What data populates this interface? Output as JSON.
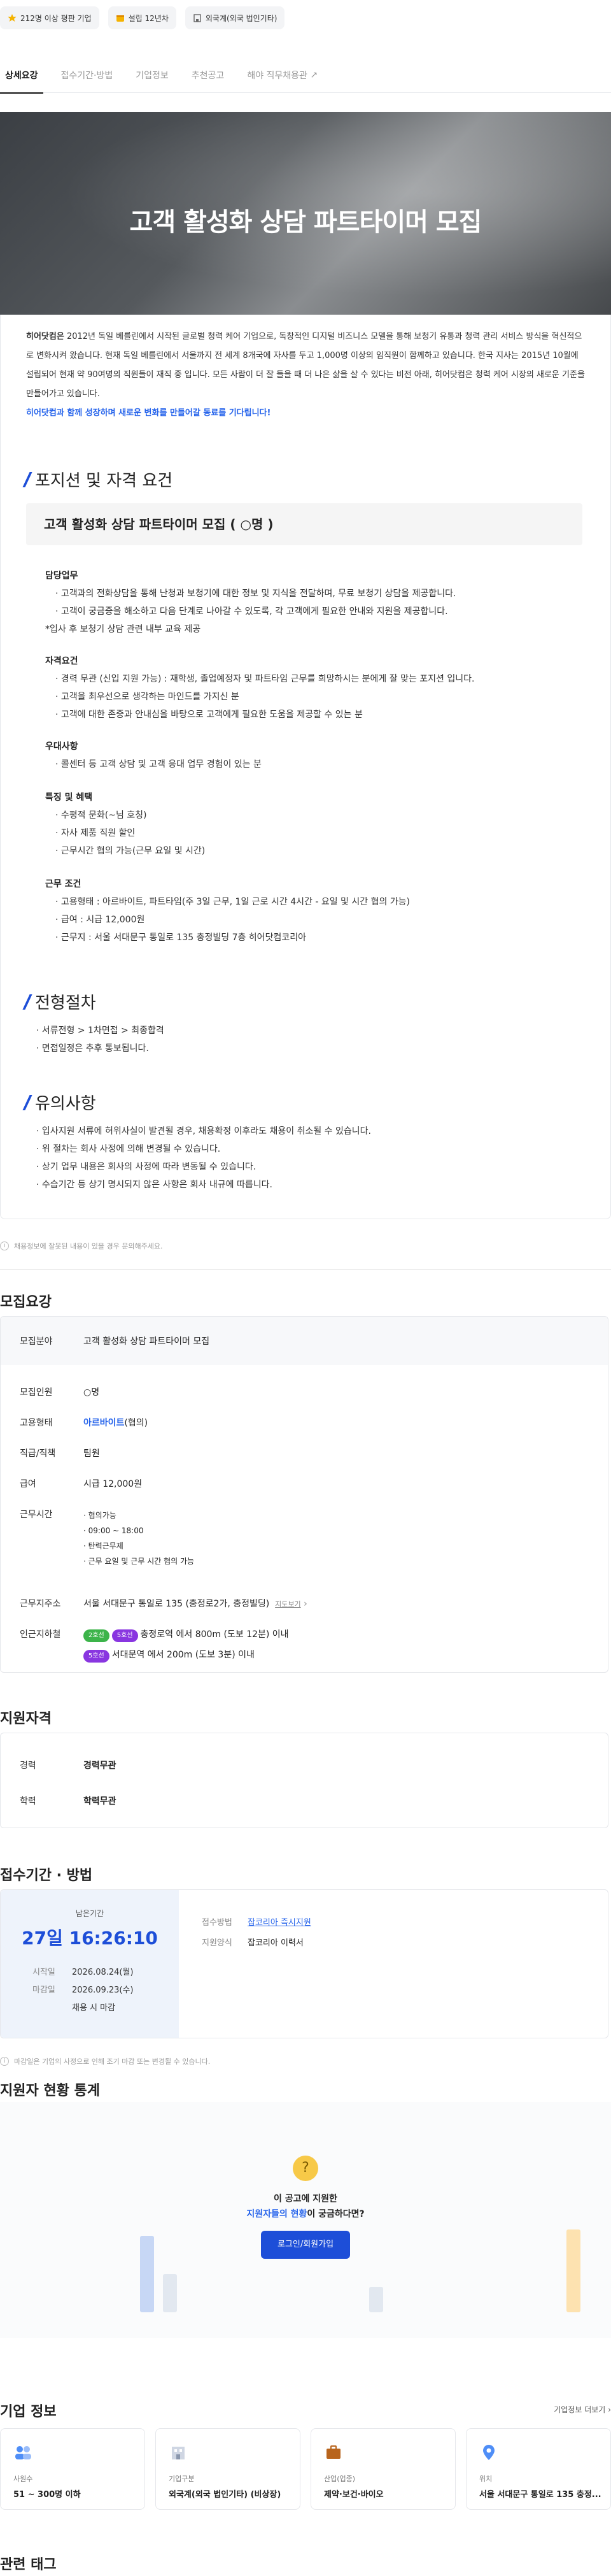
{
  "badges": [
    {
      "icon": "star-icon",
      "label": "212명 이상 평판 기업"
    },
    {
      "icon": "calendar-icon",
      "label": "설립 12년차"
    },
    {
      "icon": "building-icon",
      "label": "외국계(외국 법인기타)"
    }
  ],
  "tabs": [
    "상세요강",
    "접수기간·방법",
    "기업정보",
    "추천공고",
    "해야 직무채용관"
  ],
  "hero_title": "고객 활성화 상담 파트타이머 모집",
  "intro": {
    "company": "히어닷컴은",
    "body": " 2012년 독일 베를린에서 시작된 글로벌 청력 케어 기업으로, 독창적인 디지털 비즈니스 모델을 통해 보청기 유통과 청력 관리 서비스 방식을 혁신적으로 변화시켜 왔습니다. 현재 독일 베를린에서 서울까지 전 세계 8개국에 자사를 두고 1,000명 이상의 임직원이 함께하고 있습니다. 한국 지사는 2015년 10월에 설립되어 현재 약 90여명의 직원들이 재직 중 입니다. 모든 사람이 더 잘 들을 때 더 나은 삶을 살 수 있다는 비전 아래, 히어닷컴은 청력 케어 시장의 새로운 기준을 만들어가고 있습니다.",
    "highlight": "히어닷컴과 함께 성장하며 새로운 변화를 만들어갈 동료를 기다립니다!"
  },
  "sec_position": "포지션 및 자격 요건",
  "position_box": "고객 활성화 상담 파트타이머 모집 ( ○명 )",
  "groups": [
    {
      "title": "담당업무",
      "lines": [
        "· 고객과의 전화상담을 통해 난청과 보청기에 대한 정보 및 지식을 전달하며, 무료 보청기 상담을 제공합니다.",
        "· 고객이 궁금증을 해소하고 다음 단계로 나아갈 수 있도록, 각 고객에게 필요한 안내와 지원을 제공합니다.",
        "*입사 후 보청기 상담 관련 내부 교육 제공"
      ]
    },
    {
      "title": "자격요건",
      "lines": [
        "· 경력 무관 (신입 지원 가능) : 재학생, 졸업예정자 및 파트타임 근무를 희망하시는 분에게 잘 맞는 포지션 입니다.",
        "· 고객을 최우선으로 생각하는 마인드를 가지신 분",
        "· 고객에 대한 존중과 안내심을 바탕으로 고객에게 필요한 도움을 제공할 수 있는 분"
      ]
    },
    {
      "title": "우대사항",
      "lines": [
        "· 콜센터 등 고객 상담 및 고객 응대 업무 경험이 있는 분"
      ]
    },
    {
      "title": "특징 및 혜택",
      "lines": [
        "· 수평적 문화(~님 호칭)",
        "· 자사 제품 직원 할인",
        "· 근무시간 협의 가능(근무 요일 및 시간)"
      ]
    },
    {
      "title": "근무 조건",
      "lines": [
        "· 고용형태 : 아르바이트, 파트타임(주 3일 근무, 1일 근로 시간 4시간 - 요일 및 시간 협의 가능)",
        "· 급여 : 시급 12,000원",
        "· 근무지 : 서울 서대문구 통일로 135 충정빌딩 7층 히어닷컴코리아"
      ]
    }
  ],
  "sec_process": "전형절차",
  "process_lines": [
    "· 서류전형 > 1차면접 > 최종합격",
    "· 면접일정은 추후 통보됩니다."
  ],
  "sec_notice": "유의사항",
  "notice_lines": [
    "· 입사지원 서류에 허위사실이 발견될 경우, 채용확정 이후라도 채용이 취소될 수 있습니다.",
    "· 위 절차는 회사 사정에 의해 변경될 수 있습니다.",
    "· 상기 업무 내용은 회사의 사정에 따라 변동될 수 있습니다.",
    "· 수습기간 등 상기 명시되지 않은 사항은 회사 내규에 따릅니다."
  ],
  "detail_note": "채용정보에 잘못된 내용이 있을 경우 문의해주세요.",
  "summary": {
    "heading": "모집요강",
    "field_k": "모집분야",
    "field_v": "고객 활성화 상담 파트타이머 모집",
    "count_k": "모집인원",
    "count_v": "○명",
    "type_k": "고용형태",
    "type_v": "아르바이트",
    "type_v2": "(협의)",
    "rank_k": "직급/직책",
    "rank_v": "팀원",
    "pay_k": "급여",
    "pay_v": "시급 12,000원",
    "hours_k": "근무시간",
    "hours": [
      "협의가능",
      "09:00 ~ 18:00",
      "탄력근무제",
      "근무 요일 및 근무 시간 협의 가능"
    ],
    "addr_k": "근무지주소",
    "addr_v": "서울 서대문구 통일로 135 (충정로2가, 충정빌딩)",
    "addr_map": "지도보기",
    "near_k": "인근지하철",
    "near1_chips": [
      "2호선",
      "5호선"
    ],
    "near1": "충정로역 에서 800m (도보 12분) 이내",
    "near2_chips": [
      "5호선"
    ],
    "near2": "서대문역 에서 200m (도보 3분) 이내"
  },
  "qual": {
    "heading": "지원자격",
    "exp_k": "경력",
    "exp_v": "경력무관",
    "edu_k": "학력",
    "edu_v": "학력무관"
  },
  "apply": {
    "heading": "접수기간 · 방법",
    "left_label": "남은기간",
    "countdown": "27일 16:26:10",
    "start_k": "시작일",
    "start_v": "2026.08.24(월)",
    "end_k": "마감일",
    "end_v": "2026.09.23(수)",
    "end_note": "채용 시 마감",
    "method_k": "접수방법",
    "method_v": "잡코리아 즉시지원",
    "form_k": "지원양식",
    "form_v": "잡코리아 이력서",
    "note": "마감일은 기업의 사정으로 인해 조기 마감 또는 변경될 수 있습니다."
  },
  "stats": {
    "heading": "지원자 현황 통계",
    "q1": "이 공고에 지원한",
    "q2a": "지원자들의 현황",
    "q2b": "이 궁금하다면?",
    "btn": "로그인/회원가입"
  },
  "company": {
    "heading": "기업 정보",
    "more": "기업정보 더보기",
    "cards": [
      {
        "icon": "people-icon",
        "k": "사원수",
        "v": "51 ~ 300명 이하"
      },
      {
        "icon": "building-icon",
        "k": "기업구분",
        "v": "외국계(외국 법인기타) (비상장)"
      },
      {
        "icon": "briefcase-icon",
        "k": "산업(업종)",
        "v": "제약·보건·바이오"
      },
      {
        "icon": "location-icon",
        "k": "위치",
        "v": "서울 서대문구 통일로 135 충정..."
      }
    ]
  },
  "tags_heading": "관련 태그",
  "colors": {
    "accent": "#2563eb",
    "button": "#1d4ed8"
  }
}
